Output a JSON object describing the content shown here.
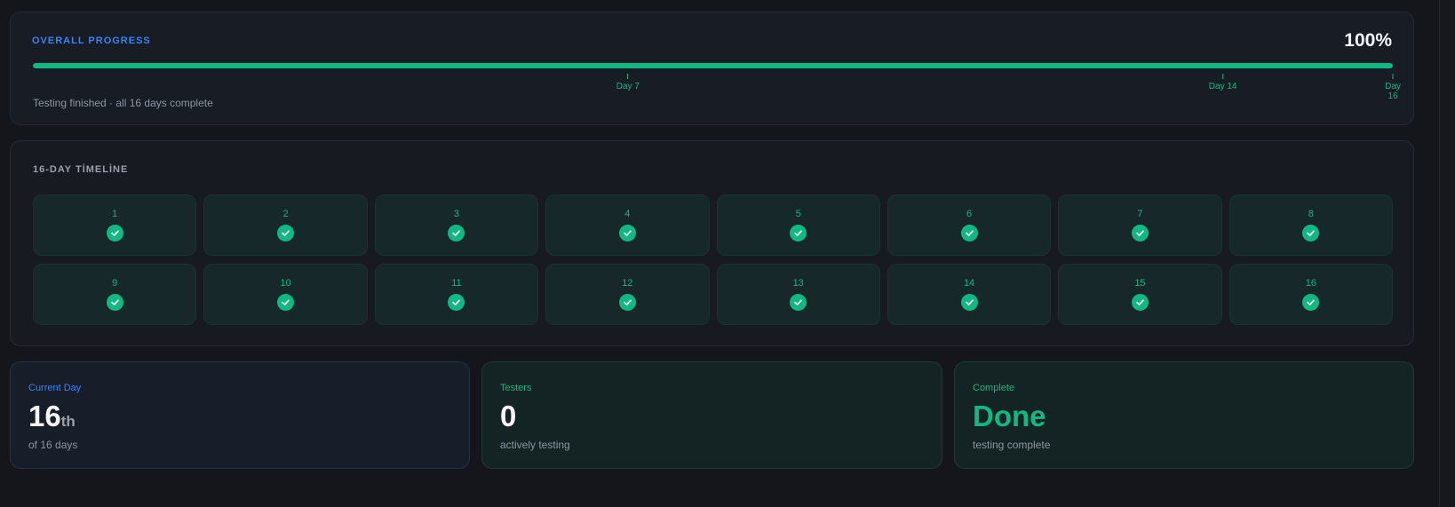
{
  "overall_progress": {
    "label": "OVERALL PROGRESS",
    "percent_text": "100%",
    "progress_fraction": 1.0,
    "status_text": "Testing finished · all 16 days complete",
    "milestones": [
      {
        "label": "Day 7",
        "day": 7
      },
      {
        "label": "Day 14",
        "day": 14
      },
      {
        "label": "Day 16",
        "day": 16
      }
    ],
    "total_days": 16
  },
  "timeline": {
    "title": "16-DAY TİMELİNE",
    "days": [
      {
        "number": "1",
        "status": "complete"
      },
      {
        "number": "2",
        "status": "complete"
      },
      {
        "number": "3",
        "status": "complete"
      },
      {
        "number": "4",
        "status": "complete"
      },
      {
        "number": "5",
        "status": "complete"
      },
      {
        "number": "6",
        "status": "complete"
      },
      {
        "number": "7",
        "status": "complete"
      },
      {
        "number": "8",
        "status": "complete"
      },
      {
        "number": "9",
        "status": "complete"
      },
      {
        "number": "10",
        "status": "complete"
      },
      {
        "number": "11",
        "status": "complete"
      },
      {
        "number": "12",
        "status": "complete"
      },
      {
        "number": "13",
        "status": "complete"
      },
      {
        "number": "14",
        "status": "complete"
      },
      {
        "number": "15",
        "status": "complete"
      },
      {
        "number": "16",
        "status": "complete"
      }
    ],
    "icon": "check-circle-icon"
  },
  "stats": {
    "current_day": {
      "label": "Current Day",
      "value": "16",
      "suffix": "th",
      "sub": "of 16 days"
    },
    "testers": {
      "label": "Testers",
      "value": "0",
      "sub": "actively testing"
    },
    "complete": {
      "label": "Complete",
      "value": "Done",
      "sub": "testing complete"
    }
  },
  "colors": {
    "accent_blue": "#3b82f6",
    "success_green": "#10b981",
    "background": "#14161b"
  }
}
